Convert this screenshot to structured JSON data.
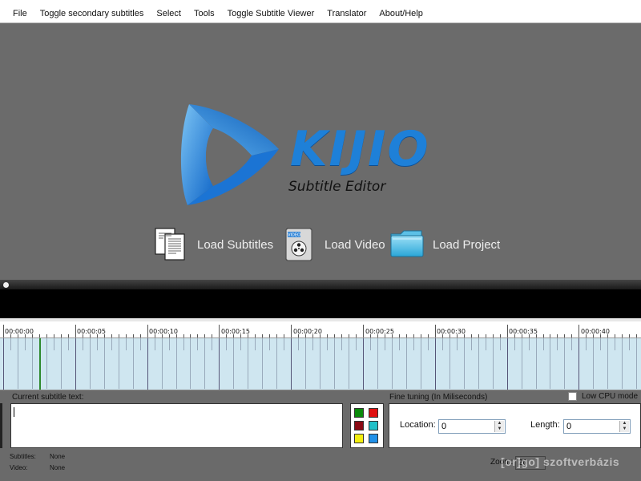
{
  "menu": {
    "items": [
      "File",
      "Toggle secondary subtitles",
      "Select",
      "Tools",
      "Toggle Subtitle Viewer",
      "Translator",
      "About/Help"
    ]
  },
  "splash": {
    "brand": "KIJIO",
    "subtitle": "Subtitle Editor",
    "actions": {
      "load_subtitles": "Load Subtitles",
      "load_video": "Load Video",
      "load_project": "Load Project"
    },
    "video_badge": "VIDEO"
  },
  "timeline": {
    "ticks": [
      "00:00:00",
      "00:00:05",
      "00:00:10",
      "00:00:15",
      "00:00:20",
      "00:00:25",
      "00:00:30",
      "00:00:35",
      "00:00:40"
    ]
  },
  "editor": {
    "current_subtitle_label": "Current subtitle text:",
    "current_subtitle_value": "",
    "fine_tuning_label": "Fine tuning (In Miliseconds)",
    "low_cpu_label": "Low CPU mode",
    "low_cpu_checked": false,
    "location_label": "Location:",
    "location_value": "0",
    "length_label": "Length:",
    "length_value": "0",
    "colors": [
      "#0a8a0a",
      "#e01010",
      "#8a0a14",
      "#20c0c8",
      "#f2ee10",
      "#2090e8"
    ]
  },
  "status": {
    "subtitles_label": "Subtitles:",
    "subtitles_value": "None",
    "video_label": "Video:",
    "video_value": "None",
    "zoom_label": "Zoom:",
    "zoom_value": "20"
  },
  "watermark": "[or]go] szoftverbázis"
}
